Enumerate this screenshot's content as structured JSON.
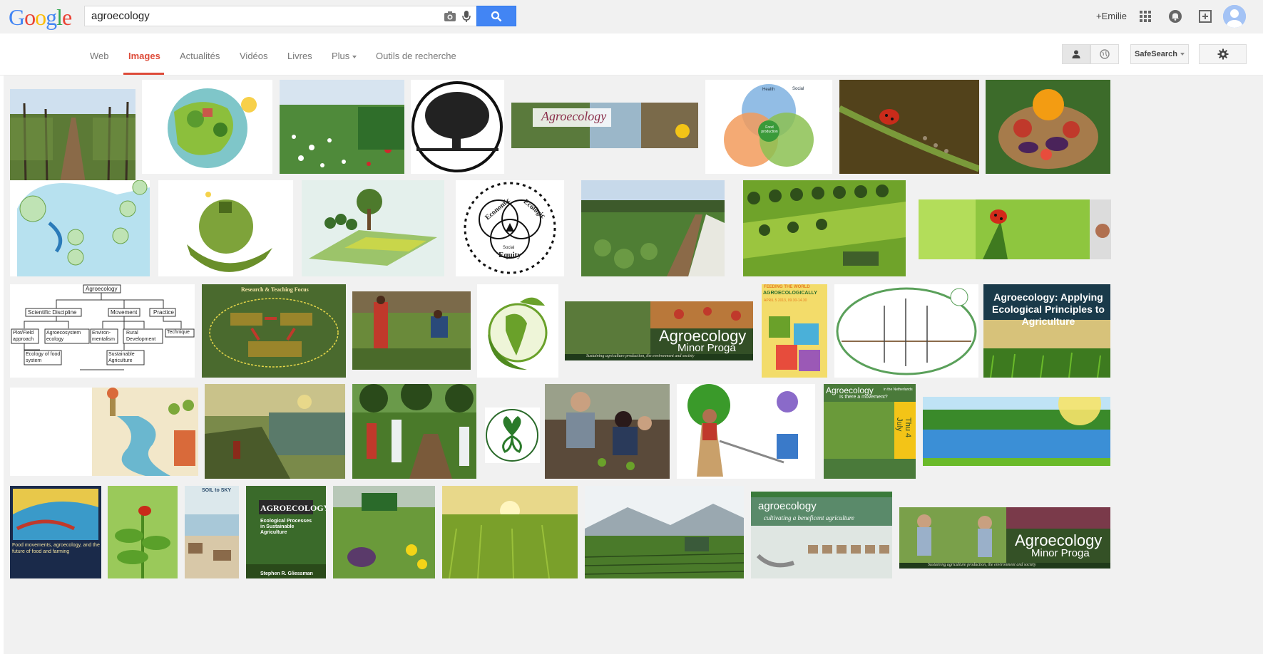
{
  "logo": "Google",
  "search": {
    "query": "agroecology"
  },
  "header": {
    "user": "+Emilie"
  },
  "nav": {
    "tabs": [
      "Web",
      "Images",
      "Actualités",
      "Vidéos",
      "Livres",
      "Plus",
      "Outils de recherche"
    ],
    "active_tab": "Images",
    "safesearch": "SafeSearch"
  },
  "thumbs": {
    "t5_title": "Agroecology",
    "t6_health": "Health",
    "t6_social": "Social",
    "t6_food": "Food production",
    "t11_economic": "Economic",
    "t11_ecologic": "Ecologic",
    "t11_social": "Social",
    "t11_equity": "Equity",
    "t15_root": "Agroecology",
    "t15_n1": "Scientific Discipline",
    "t15_n2": "Movement",
    "t15_n3": "Practice",
    "t15_n4": "Plot/Field approach",
    "t15_n5": "Agroecosystem ecology",
    "t15_n6": "Environ-mentalism",
    "t15_n7": "Rural Development",
    "t15_n8": "Technique",
    "t15_n9": "Ecology of food system",
    "t15_n10": "Sustainable Agriculture",
    "t16_title": "Research & Teaching Focus",
    "t19_title": "Agroecology",
    "t19_sub": "Minor Proga",
    "t19_tag": "Sustaining agriculture production, the environment and society",
    "t20_l1": "FEEDING THE WORLD",
    "t20_l2": "AGROECOLOGICALLY",
    "t20_l3": "APRIL 5 2013, 09.30-14.30",
    "t22_l1": "Agroecology: Applying",
    "t22_l2": "Ecological Principles to",
    "t22_l3": "Agriculture",
    "t29_title": "Agroecology",
    "t29_sub": "in the Netherlands",
    "t29_q": "Is there a movement?",
    "t29_date": "Thu 4 July",
    "t31_l1": "Food movements, agroecology, and the",
    "t31_l2": "future of food and farming",
    "t33_title": "SOIL to SKY",
    "t34_title": "AGROECOLOGY",
    "t34_sub": "Ecological Processes in Sustainable Agriculture",
    "t34_author": "Stephen R. Gliessman",
    "t38_title": "agroecology",
    "t38_sub": "cultivating a beneficent agriculture",
    "t39_title": "Agroecology",
    "t39_sub": "Minor Proga",
    "t39_tag": "Sustaining agriculture production, the environment and society"
  }
}
